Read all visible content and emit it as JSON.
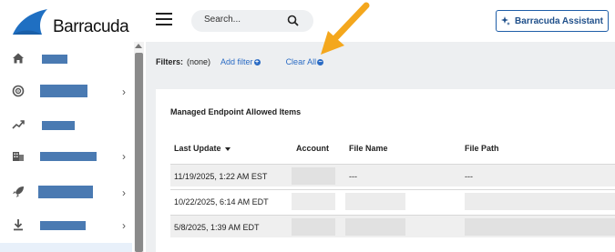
{
  "brand": {
    "name": "Barracuda",
    "accent": "#2a6bc4"
  },
  "header": {
    "search_placeholder": "Search...",
    "assistant_label": "Barracuda Assistant"
  },
  "sidebar": {
    "items": [
      {
        "icon": "home-icon",
        "has_chevron": false
      },
      {
        "icon": "radar-icon",
        "has_chevron": true
      },
      {
        "icon": "trending-up-icon",
        "has_chevron": false
      },
      {
        "icon": "building-icon",
        "has_chevron": true
      },
      {
        "icon": "rocket-icon",
        "has_chevron": true
      },
      {
        "icon": "download-icon",
        "has_chevron": true
      }
    ]
  },
  "filters": {
    "label": "Filters:",
    "value": "(none)",
    "add_filter": "Add filter",
    "clear_all": "Clear All"
  },
  "table": {
    "title": "Managed Endpoint Allowed Items",
    "columns": [
      "Last Update",
      "Account",
      "File Name",
      "File Path"
    ],
    "rows": [
      {
        "last_update": "11/19/2025, 1:22 AM EST",
        "file_name": "---",
        "file_path": "---"
      },
      {
        "last_update": "10/22/2025, 6:14 AM EDT",
        "file_name": "",
        "file_path": ""
      },
      {
        "last_update": "5/8/2025, 1:39 AM EDT",
        "file_name": "",
        "file_path": ""
      }
    ]
  }
}
